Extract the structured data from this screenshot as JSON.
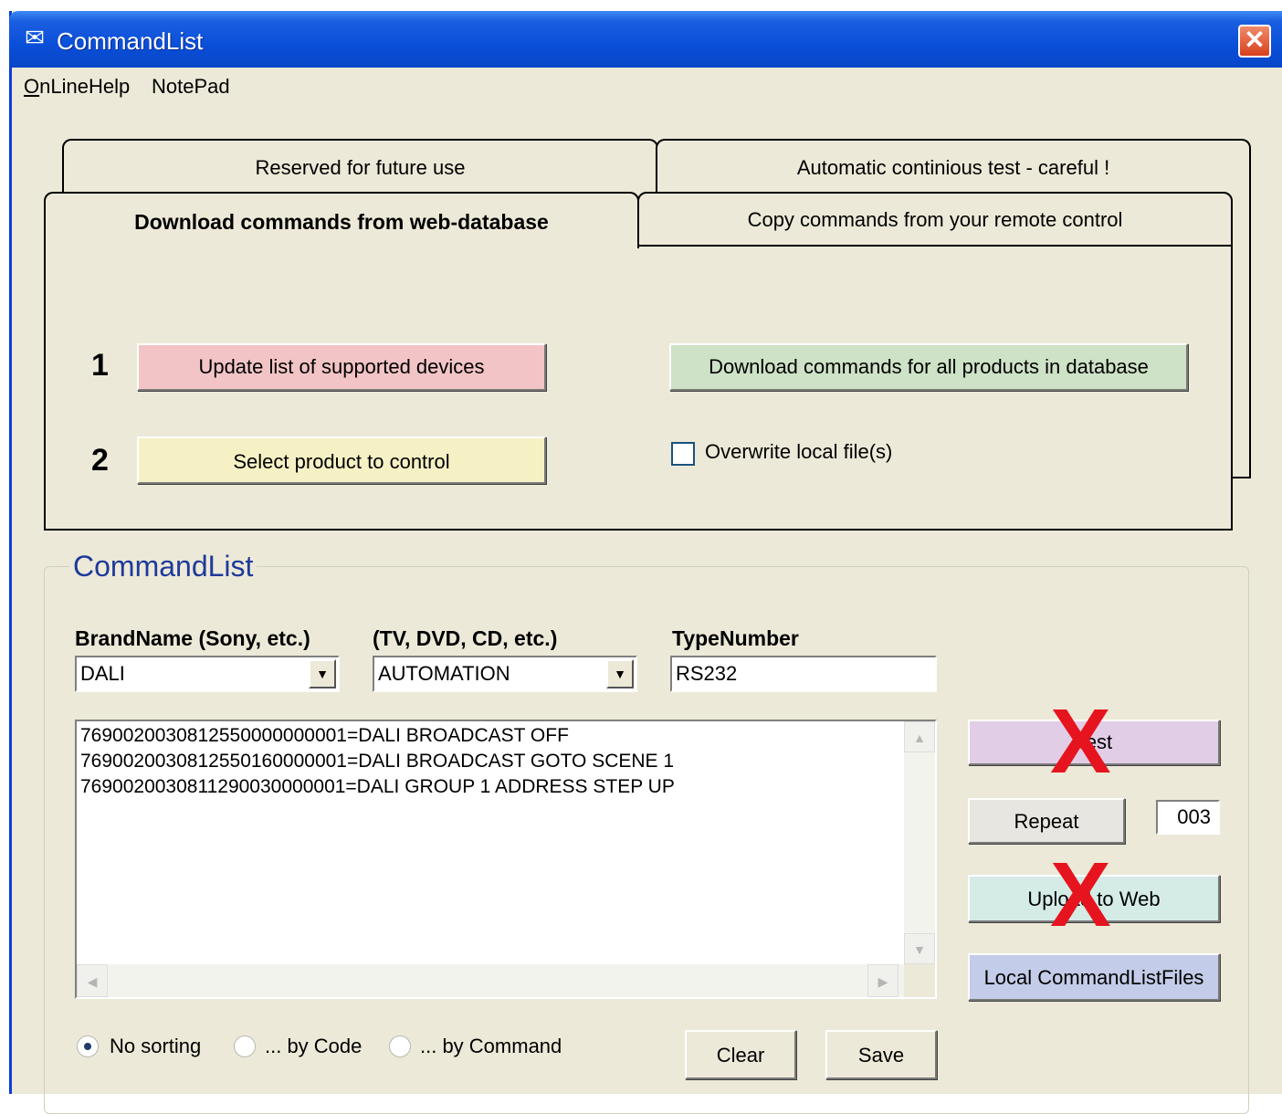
{
  "window": {
    "title": "CommandList",
    "close_label": "✕"
  },
  "menu": {
    "items": [
      {
        "label": "OnLineHelp"
      },
      {
        "label": "NotePad"
      }
    ]
  },
  "tabs": {
    "back_row": [
      {
        "label": "Reserved for future use"
      },
      {
        "label": "Automatic continious test - careful !"
      }
    ],
    "front_row": [
      {
        "label": "Download commands from web-database",
        "active": true
      },
      {
        "label": "Copy commands from your remote control",
        "active": false
      }
    ]
  },
  "download_panel": {
    "step1_num": "1",
    "step2_num": "2",
    "update_label": "Update list of supported devices",
    "select_label": "Select product to control",
    "download_all_label": "Download commands for all products in database",
    "overwrite_label": "Overwrite local file(s)",
    "overwrite_checked": false
  },
  "commandlist": {
    "group_title": "CommandList",
    "brand_label": "BrandName (Sony, etc.)",
    "type_label": "(TV, DVD, CD, etc.)",
    "typenumber_label": "TypeNumber",
    "brand_value": "DALI",
    "type_value": "AUTOMATION",
    "typenumber_value": "RS232",
    "lines": [
      "7690020030812550000000001=DALI BROADCAST OFF",
      "7690020030812550160000001=DALI BROADCAST GOTO SCENE 1",
      "7690020030811290030000001=DALI GROUP 1 ADDRESS STEP UP"
    ],
    "test_label": "Test",
    "repeat_label": "Repeat",
    "repeat_value": "003",
    "upload_label": "Upload to Web",
    "local_files_label": "Local CommandListFiles",
    "x_mark": "X",
    "sort_options": [
      {
        "label": "No sorting",
        "checked": true
      },
      {
        "label": "... by Code",
        "checked": false
      },
      {
        "label": "... by Command",
        "checked": false
      }
    ],
    "clear_label": "Clear",
    "save_label": "Save"
  },
  "colors": {
    "title_bar": "#0a4fd8",
    "update_button": "#f2c4c6",
    "select_button": "#f6f1c4",
    "download_all_button": "#cde2c6",
    "test_button": "#e2cde6",
    "upload_button": "#d4ebe6",
    "local_files_button": "#c3cce8",
    "x_mark": "#e6141e",
    "group_title": "#1e3a9a"
  }
}
